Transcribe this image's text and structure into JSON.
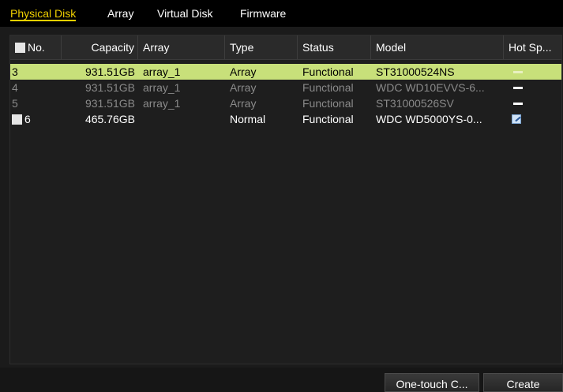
{
  "tabs": [
    {
      "label": "Physical Disk",
      "active": true
    },
    {
      "label": "Array",
      "active": false
    },
    {
      "label": "Virtual Disk",
      "active": false
    },
    {
      "label": "Firmware",
      "active": false
    }
  ],
  "table": {
    "columns": [
      "No.",
      "Capacity",
      "Array",
      "Type",
      "Status",
      "Model",
      "Hot Sp..."
    ],
    "rows": [
      {
        "no": "3",
        "capacity": "931.51GB",
        "array": "array_1",
        "type": "Array",
        "status": "Functional",
        "model": "ST31000524NS",
        "hot_spare_icon": "dash-icon",
        "state": "selected"
      },
      {
        "no": "4",
        "capacity": "931.51GB",
        "array": "array_1",
        "type": "Array",
        "status": "Functional",
        "model": "WDC WD10EVVS-6...",
        "hot_spare_icon": "dash-icon",
        "state": "disabled"
      },
      {
        "no": "5",
        "capacity": "931.51GB",
        "array": "array_1",
        "type": "Array",
        "status": "Functional",
        "model": "ST31000526SV",
        "hot_spare_icon": "dash-icon",
        "state": "disabled"
      },
      {
        "no": "6",
        "capacity": "465.76GB",
        "array": "",
        "type": "Normal",
        "status": "Functional",
        "model": "WDC WD5000YS-0...",
        "hot_spare_icon": "edit-icon",
        "state": "normal",
        "checkbox": true
      }
    ]
  },
  "buttons": {
    "one_touch": "One-touch C...",
    "create": "Create"
  },
  "colors": {
    "active_tab": "#f0d000",
    "selected_row": "#c8e07a",
    "background": "#1b1b1b"
  }
}
